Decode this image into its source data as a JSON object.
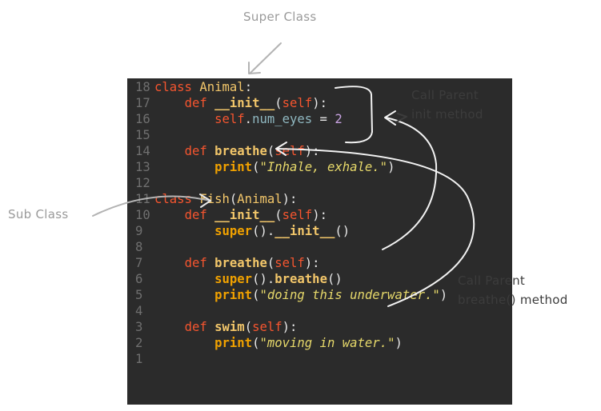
{
  "annotations": {
    "super_class": "Super Class",
    "sub_class": "Sub Class",
    "call_parent_init_1": "Call Parent",
    "call_parent_init_2": "init method",
    "call_parent_breathe_1": "Call Parent",
    "call_parent_breathe_2": "breathe() method"
  },
  "code": [
    {
      "n": "18",
      "t": [
        [
          "kw",
          "class "
        ],
        [
          "cls",
          "Animal"
        ],
        [
          "punc",
          ":"
        ]
      ]
    },
    {
      "n": "17",
      "t": [
        [
          "",
          "    "
        ],
        [
          "kw",
          "def "
        ],
        [
          "fn",
          "__init__"
        ],
        [
          "punc",
          "("
        ],
        [
          "self",
          "self"
        ],
        [
          "punc",
          "):"
        ]
      ]
    },
    {
      "n": "16",
      "t": [
        [
          "",
          "        "
        ],
        [
          "self",
          "self"
        ],
        [
          "punc",
          "."
        ],
        [
          "attr",
          "num_eyes"
        ],
        [
          "op",
          " = "
        ],
        [
          "num",
          "2"
        ]
      ]
    },
    {
      "n": "15",
      "t": []
    },
    {
      "n": "14",
      "t": [
        [
          "",
          "    "
        ],
        [
          "kw",
          "def "
        ],
        [
          "fn",
          "breathe"
        ],
        [
          "punc",
          "("
        ],
        [
          "self",
          "self"
        ],
        [
          "punc",
          "):"
        ]
      ]
    },
    {
      "n": "13",
      "t": [
        [
          "",
          "        "
        ],
        [
          "bi",
          "print"
        ],
        [
          "punc",
          "("
        ],
        [
          "q",
          "\""
        ],
        [
          "str",
          "Inhale, exhale."
        ],
        [
          "q",
          "\""
        ],
        [
          "punc",
          ")"
        ]
      ]
    },
    {
      "n": "12",
      "t": []
    },
    {
      "n": "11",
      "t": [
        [
          "kw",
          "class "
        ],
        [
          "cls",
          "Fish"
        ],
        [
          "punc",
          "("
        ],
        [
          "cls",
          "Animal"
        ],
        [
          "punc",
          "):"
        ]
      ]
    },
    {
      "n": "10",
      "t": [
        [
          "",
          "    "
        ],
        [
          "kw",
          "def "
        ],
        [
          "fn",
          "__init__"
        ],
        [
          "punc",
          "("
        ],
        [
          "self",
          "self"
        ],
        [
          "punc",
          "):"
        ]
      ]
    },
    {
      "n": "9",
      "t": [
        [
          "",
          "        "
        ],
        [
          "bi",
          "super"
        ],
        [
          "punc",
          "()."
        ],
        [
          "fn",
          "__init__"
        ],
        [
          "punc",
          "()"
        ]
      ]
    },
    {
      "n": "8",
      "t": []
    },
    {
      "n": "7",
      "t": [
        [
          "",
          "    "
        ],
        [
          "kw",
          "def "
        ],
        [
          "fn",
          "breathe"
        ],
        [
          "punc",
          "("
        ],
        [
          "self",
          "self"
        ],
        [
          "punc",
          "):"
        ]
      ]
    },
    {
      "n": "6",
      "t": [
        [
          "",
          "        "
        ],
        [
          "bi",
          "super"
        ],
        [
          "punc",
          "()."
        ],
        [
          "fn",
          "breathe"
        ],
        [
          "punc",
          "()"
        ]
      ]
    },
    {
      "n": "5",
      "t": [
        [
          "",
          "        "
        ],
        [
          "bi",
          "print"
        ],
        [
          "punc",
          "("
        ],
        [
          "q",
          "\""
        ],
        [
          "str",
          "doing this underwater."
        ],
        [
          "q",
          "\""
        ],
        [
          "punc",
          ")"
        ]
      ]
    },
    {
      "n": "4",
      "t": []
    },
    {
      "n": "3",
      "t": [
        [
          "",
          "    "
        ],
        [
          "kw",
          "def "
        ],
        [
          "fn",
          "swim"
        ],
        [
          "punc",
          "("
        ],
        [
          "self",
          "self"
        ],
        [
          "punc",
          "):"
        ]
      ]
    },
    {
      "n": "2",
      "t": [
        [
          "",
          "        "
        ],
        [
          "bi",
          "print"
        ],
        [
          "punc",
          "("
        ],
        [
          "q",
          "\""
        ],
        [
          "str",
          "moving in water."
        ],
        [
          "q",
          "\""
        ],
        [
          "punc",
          ")"
        ]
      ]
    },
    {
      "n": "1",
      "t": []
    }
  ]
}
